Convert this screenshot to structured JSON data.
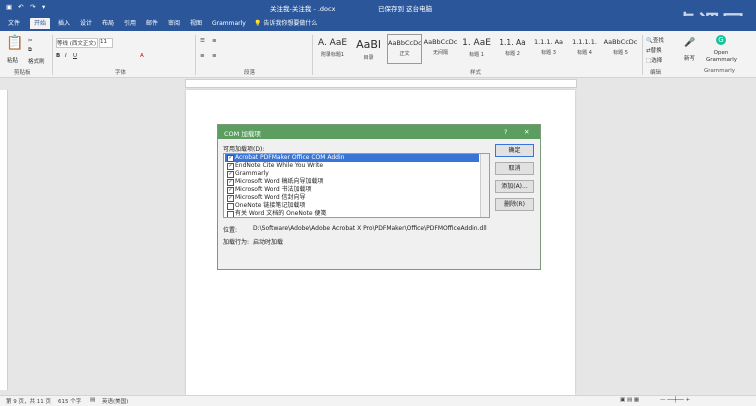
{
  "title_bar": {
    "file_name": "关注我-关注我 - .docx",
    "status": "已保存到 这台电脑",
    "quick_icons": [
      "save-icon",
      "undo-icon",
      "redo-icon",
      "customize-icon"
    ]
  },
  "tabs": [
    "文件",
    "开始",
    "插入",
    "设计",
    "布局",
    "引用",
    "邮件",
    "审阅",
    "视图",
    "Grammarly"
  ],
  "active_tab": "开始",
  "tell_me": "告诉我你想要做什么",
  "ribbon": {
    "clipboard": {
      "label": "剪贴板",
      "paste": "粘贴",
      "format_painter": "格式刷"
    },
    "font": {
      "label": "字体",
      "name": "等线 (西文正文)",
      "size": "11"
    },
    "paragraph": {
      "label": "段落"
    },
    "styles": {
      "label": "样式",
      "items": [
        {
          "preview": "A. AaE",
          "name": "附录标题1"
        },
        {
          "preview": "AaBl",
          "name": "目录"
        },
        {
          "preview": "AaBbCcDc",
          "name": "正文"
        },
        {
          "preview": "AaBbCcDc",
          "name": "无间隔"
        },
        {
          "preview": "1. AaE",
          "name": "标题 1"
        },
        {
          "preview": "1.1. Aa",
          "name": "标题 2"
        },
        {
          "preview": "1.1.1. Aa",
          "name": "标题 3"
        },
        {
          "preview": "1.1.1.1.",
          "name": "标题 4"
        },
        {
          "preview": "AaBbCcDc",
          "name": "标题 5"
        }
      ]
    },
    "editing": {
      "label": "编辑",
      "find": "查找",
      "replace": "替换",
      "select": "选择"
    },
    "review": {
      "label": "新写"
    },
    "grammarly": {
      "label": "Grammarly",
      "open": "Open Grammarly"
    }
  },
  "dialog": {
    "title": "COM 加载项",
    "help": "?",
    "close": "✕",
    "list_label": "可用加载项(D):",
    "addins": [
      {
        "name": "Acrobat PDFMaker Office COM Addin",
        "checked": true,
        "selected": true
      },
      {
        "name": "EndNote Cite While You Write",
        "checked": true,
        "selected": false
      },
      {
        "name": "Grammarly",
        "checked": true,
        "selected": false
      },
      {
        "name": "Microsoft Word 稿纸向导加载项",
        "checked": true,
        "selected": false
      },
      {
        "name": "Microsoft Word 书法加载项",
        "checked": true,
        "selected": false
      },
      {
        "name": "Microsoft Word 信封向导",
        "checked": true,
        "selected": false
      },
      {
        "name": "OneNote 链接笔记加载项",
        "checked": false,
        "selected": false
      },
      {
        "name": "有关 Word 文档的 OneNote 便笺",
        "checked": false,
        "selected": false
      }
    ],
    "buttons": {
      "ok": "确定",
      "cancel": "取消",
      "add": "添加(A)...",
      "remove": "删除(R)"
    },
    "location_label": "位置:",
    "location_value": "D:\\Software\\Adobe\\Adobe Acrobat X Pro\\PDFMaker\\Office\\PDFMOfficeAddin.dll",
    "behavior_label": "加载行为:",
    "behavior_value": "启动时加载"
  },
  "status_bar": {
    "page": "第 9 页，共 11 页",
    "words": "615 个字",
    "lang": "英语(美国)"
  },
  "watermark": "虎课网",
  "colors": {
    "title_bar": "#2b579a",
    "dialog_title": "#5b9e5f",
    "selection": "#3875d7"
  }
}
